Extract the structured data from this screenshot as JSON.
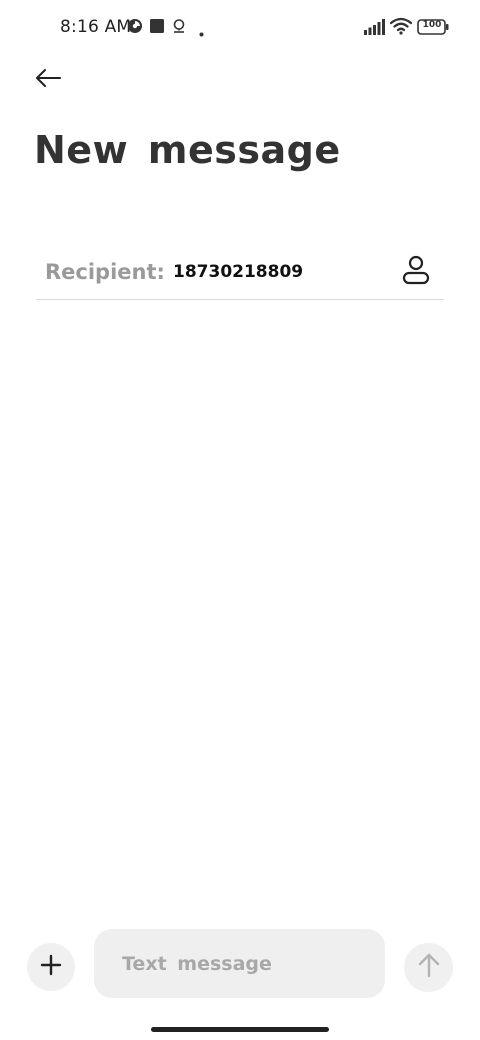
{
  "status_bar": {
    "time": "8:16 AM",
    "left_icons": [
      "circle-progress-icon",
      "stop-square-icon",
      "location-pin-icon",
      "dot-icon"
    ],
    "right_icons": [
      "cellular-signal-icon",
      "wifi-icon",
      "battery-icon"
    ],
    "battery_level": "100"
  },
  "header": {
    "back_icon": "arrow-left-icon",
    "title": "New message"
  },
  "recipient": {
    "label": "Recipient:",
    "value": "18730218809",
    "contact_icon": "person-icon"
  },
  "composer": {
    "add_icon": "plus-icon",
    "placeholder": "Text message",
    "send_icon": "arrow-up-icon"
  },
  "colors": {
    "background": "#ffffff",
    "title": "#333333",
    "label_gray": "#9a9a9a",
    "field_bg": "#efefef",
    "divider": "#dddddd"
  }
}
